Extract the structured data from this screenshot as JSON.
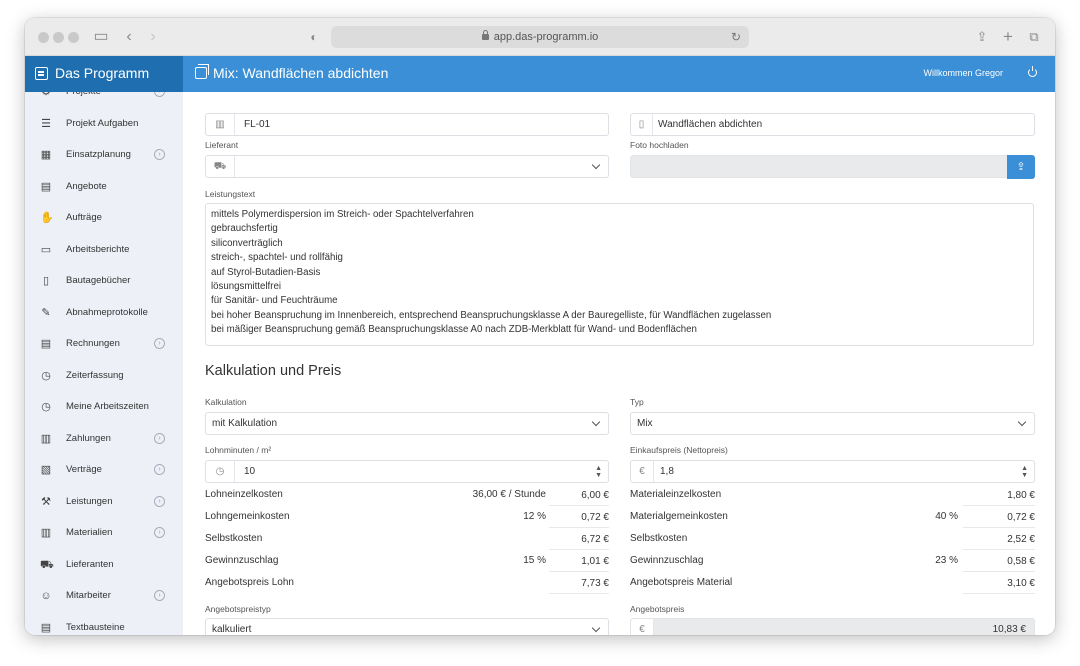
{
  "browser": {
    "url": "app.das-programm.io"
  },
  "app": {
    "brand": "Das Programm",
    "page_title": "Mix: Wandflächen abdichten",
    "welcome": "Willkommen Gregor"
  },
  "sidebar": {
    "items": [
      {
        "label": "Projekte",
        "icon": "projects-icon",
        "glyph": "⚙",
        "expandable": true
      },
      {
        "label": "Projekt Aufgaben",
        "icon": "tasks-icon",
        "glyph": "☰",
        "expandable": false
      },
      {
        "label": "Einsatzplanung",
        "icon": "calendar-icon",
        "glyph": "▦",
        "expandable": true
      },
      {
        "label": "Angebote",
        "icon": "calculator-icon",
        "glyph": "▤",
        "expandable": false
      },
      {
        "label": "Aufträge",
        "icon": "handshake-icon",
        "glyph": "✋",
        "expandable": false
      },
      {
        "label": "Arbeitsberichte",
        "icon": "report-icon",
        "glyph": "▭",
        "expandable": false
      },
      {
        "label": "Bautagebücher",
        "icon": "book-icon",
        "glyph": "▯",
        "expandable": false
      },
      {
        "label": "Abnahmeprotokolle",
        "icon": "signature-icon",
        "glyph": "✎",
        "expandable": false
      },
      {
        "label": "Rechnungen",
        "icon": "invoice-icon",
        "glyph": "▤",
        "expandable": true
      },
      {
        "label": "Zeiterfassung",
        "icon": "clock-icon",
        "glyph": "◷",
        "expandable": false
      },
      {
        "label": "Meine Arbeitszeiten",
        "icon": "clock-icon",
        "glyph": "◷",
        "expandable": false
      },
      {
        "label": "Zahlungen",
        "icon": "cash-register-icon",
        "glyph": "▥",
        "expandable": true
      },
      {
        "label": "Verträge",
        "icon": "contract-icon",
        "glyph": "▧",
        "expandable": true
      },
      {
        "label": "Leistungen",
        "icon": "hammer-icon",
        "glyph": "⚒",
        "expandable": true
      },
      {
        "label": "Materialien",
        "icon": "barcode-icon",
        "glyph": "▥",
        "expandable": true
      },
      {
        "label": "Lieferanten",
        "icon": "truck-icon",
        "glyph": "⛟",
        "expandable": false
      },
      {
        "label": "Mitarbeiter",
        "icon": "users-icon",
        "glyph": "☺",
        "expandable": true
      },
      {
        "label": "Textbausteine",
        "icon": "document-icon",
        "glyph": "▤",
        "expandable": false
      }
    ]
  },
  "form": {
    "code_value": "FL-01",
    "name_value": "Wandflächen abdichten",
    "supplier_label": "Lieferant",
    "supplier_value": "",
    "photo_label": "Foto hochladen",
    "description_label": "Leistungstext",
    "description_lines": [
      "mittels Polymerdispersion im Streich- oder Spachtelverfahren",
      "gebrauchsfertig",
      "siliconverträglich",
      "streich-, spachtel- und rollfähig",
      "auf Styrol-Butadien-Basis",
      "lösungsmittelfrei",
      "für Sanitär- und Feuchträume",
      "bei hoher Beanspruchung im Innenbereich, entsprechend Beanspruchungsklasse A der Bauregelliste, für Wandflächen zugelassen",
      "bei mäßiger Beanspruchung gemäß Beanspruchungsklasse A0 nach ZDB-Merkblatt für Wand- und Bodenflächen"
    ]
  },
  "calc": {
    "section_title": "Kalkulation und Preis",
    "kalkulation_label": "Kalkulation",
    "kalkulation_value": "mit Kalkulation",
    "typ_label": "Typ",
    "typ_value": "Mix",
    "lohnminuten_label": "Lohnminuten / m²",
    "lohnminuten_value": "10",
    "einkaufspreis_label": "Einkaufspreis (Nettopreis)",
    "einkaufspreis_currency": "€",
    "einkaufspreis_value": "1,8",
    "left_rows": [
      {
        "label": "Lohneinzelkosten",
        "param": "36,00 € / Stunde",
        "value": "6,00 €"
      },
      {
        "label": "Lohngemeinkosten",
        "param": "12 %",
        "value": "0,72 €"
      },
      {
        "label": "Selbstkosten",
        "param": "",
        "value": "6,72 €"
      },
      {
        "label": "Gewinnzuschlag",
        "param": "15 %",
        "value": "1,01 €"
      },
      {
        "label": "Angebotspreis Lohn",
        "param": "",
        "value": "7,73 €"
      }
    ],
    "right_rows": [
      {
        "label": "Materialeinzelkosten",
        "param": "",
        "value": "1,80 €"
      },
      {
        "label": "Materialgemeinkosten",
        "param": "40 %",
        "value": "0,72 €"
      },
      {
        "label": "Selbstkosten",
        "param": "",
        "value": "2,52 €"
      },
      {
        "label": "Gewinnzuschlag",
        "param": "23 %",
        "value": "0,58 €"
      },
      {
        "label": "Angebotspreis Material",
        "param": "",
        "value": "3,10 €"
      }
    ],
    "angebotspreistyp_label": "Angebotspreistyp",
    "angebotspreistyp_value": "kalkuliert",
    "angebotspreis_label": "Angebotspreis",
    "angebotspreis_currency": "€",
    "angebotspreis_value": "10,83 €"
  },
  "colors": {
    "brand_dark": "#1f6fb0",
    "brand": "#3a8fd6",
    "sidebar_bg": "#edf1f7"
  }
}
